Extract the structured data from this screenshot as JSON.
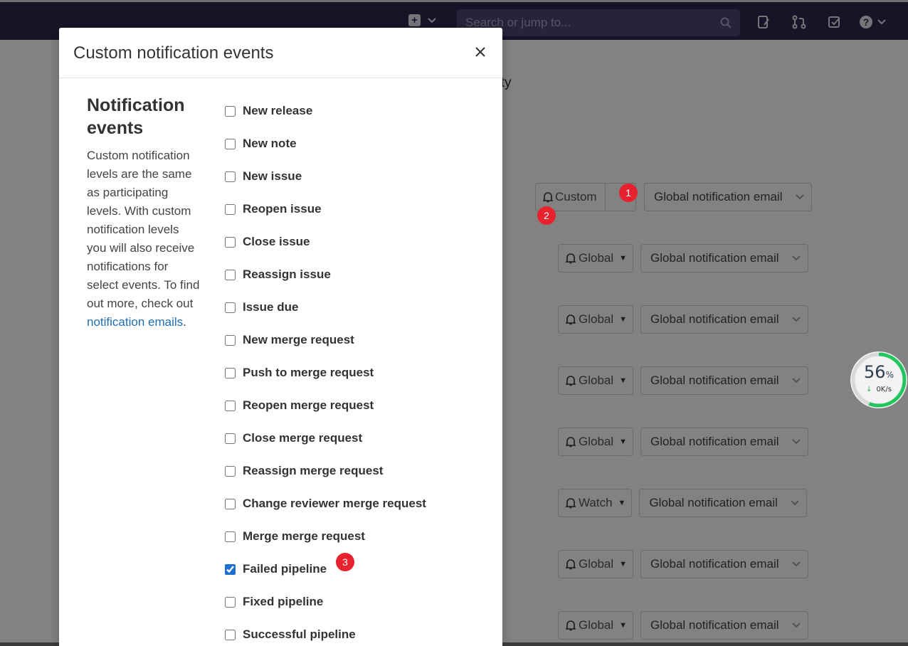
{
  "navbar": {
    "search_placeholder": "Search or jump to..."
  },
  "background": {
    "heading_fragment": "vity",
    "custom_button_label": "Custom",
    "rows": [
      {
        "level": "Global",
        "email": "Global notification email"
      },
      {
        "level": "Global",
        "email": "Global notification email"
      },
      {
        "level": "Global",
        "email": "Global notification email"
      },
      {
        "level": "Global",
        "email": "Global notification email"
      },
      {
        "level": "Watch",
        "email": "Global notification email"
      },
      {
        "level": "Global",
        "email": "Global notification email"
      },
      {
        "level": "Global",
        "email": "Global notification email"
      }
    ],
    "custom_row_email": "Global notification email"
  },
  "modal": {
    "title": "Custom notification events",
    "side_title": "Notification events",
    "side_description": "Custom notification levels are the same as participating levels. With custom notification levels you will also receive notifications for select events. To find out more, check out",
    "side_link": "notification emails",
    "side_link_suffix": ".",
    "events": [
      {
        "label": "New release",
        "checked": false
      },
      {
        "label": "New note",
        "checked": false
      },
      {
        "label": "New issue",
        "checked": false
      },
      {
        "label": "Reopen issue",
        "checked": false
      },
      {
        "label": "Close issue",
        "checked": false
      },
      {
        "label": "Reassign issue",
        "checked": false
      },
      {
        "label": "Issue due",
        "checked": false
      },
      {
        "label": "New merge request",
        "checked": false
      },
      {
        "label": "Push to merge request",
        "checked": false
      },
      {
        "label": "Reopen merge request",
        "checked": false
      },
      {
        "label": "Close merge request",
        "checked": false
      },
      {
        "label": "Reassign merge request",
        "checked": false
      },
      {
        "label": "Change reviewer merge request",
        "checked": false
      },
      {
        "label": "Merge merge request",
        "checked": false
      },
      {
        "label": "Failed pipeline",
        "checked": true
      },
      {
        "label": "Fixed pipeline",
        "checked": false
      },
      {
        "label": "Successful pipeline",
        "checked": false
      }
    ]
  },
  "markers": [
    "1",
    "2",
    "3"
  ],
  "speed_widget": {
    "percent": "56",
    "percent_unit": "%",
    "rate": "0K/s",
    "percent_value": 56
  },
  "colors": {
    "navbar": "#2c2a4f",
    "link": "#1f6fb5",
    "marker": "#e8212e",
    "speed_ring": "#22c55e"
  }
}
